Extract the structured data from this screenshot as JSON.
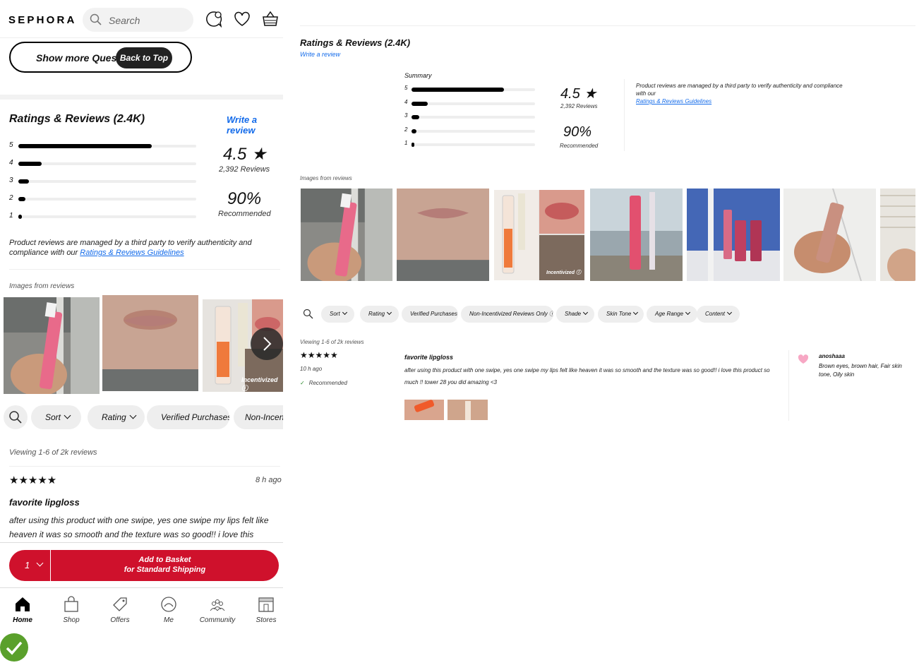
{
  "mobile": {
    "brand": "SEPHORA",
    "search_placeholder": "Search",
    "show_more": "Show more Questions",
    "back_to_top": "Back to Top",
    "section_title": "Ratings & Reviews (2.4K)",
    "write_review": "Write a review",
    "histogram": [
      {
        "label": "5",
        "value": 0.75
      },
      {
        "label": "4",
        "value": 0.13
      },
      {
        "label": "3",
        "value": 0.06
      },
      {
        "label": "2",
        "value": 0.04
      },
      {
        "label": "1",
        "value": 0.02
      }
    ],
    "rating": "4.5 ★",
    "review_count": "2,392 Reviews",
    "recommended_pct": "90%",
    "recommended_label": "Recommended",
    "disclaimer": "Product reviews are managed by a third party to verify authenticity and compliance with our",
    "guidelines_link": "Ratings & Reviews Guidelines",
    "images_label": "Images from reviews",
    "incentivized": "Incentivized ⓘ",
    "chips": [
      "Sort",
      "Rating",
      "Verified Purchases",
      "Non-Incentivi"
    ],
    "viewing": "Viewing 1-6 of 2k reviews",
    "stars": "★★★★★",
    "time_ago": "8 h ago",
    "review_title": "favorite lipgloss",
    "review_text": "after using this product with one swipe, yes one swipe my lips felt like heaven it was so smooth and the texture was so good!! i love this product",
    "qty": "1",
    "add_basket": "Add to Basket",
    "shipping": "for Standard Shipping",
    "nav": [
      "Home",
      "Shop",
      "Offers",
      "Me",
      "Community",
      "Stores"
    ]
  },
  "desktop": {
    "section_title": "Ratings & Reviews (2.4K)",
    "write_review": "Write a review",
    "summary": "Summary",
    "histogram": [
      {
        "label": "5",
        "value": 0.75
      },
      {
        "label": "4",
        "value": 0.13
      },
      {
        "label": "3",
        "value": 0.06
      },
      {
        "label": "2",
        "value": 0.04
      },
      {
        "label": "1",
        "value": 0.02
      }
    ],
    "rating": "4.5 ★",
    "review_count": "2,392 Reviews",
    "recommended_pct": "90%",
    "recommended_label": "Recommended",
    "disclaimer": "Product reviews are managed by a third party to verify authenticity and compliance with our",
    "guidelines_link": "Ratings & Reviews Guidelines",
    "images_label": "Images from reviews",
    "incentivized": "Incentivized ⓘ",
    "chips": [
      "Sort",
      "Rating",
      "Verified Purchases",
      "Non-Incentivized Reviews Only ⓘ",
      "Shade",
      "Skin Tone",
      "Age Range",
      "Content"
    ],
    "viewing": "Viewing 1-6 of 2k reviews",
    "stars": "★★★★★",
    "time_ago": "10 h ago",
    "recommended_tag": "Recommended",
    "review_title": "favorite lipgloss",
    "review_text": "after using this product with one swipe, yes one swipe my lips felt like heaven it was so smooth and the texture was so good!! i love this product so much !! tower 28 you did amazing <3",
    "username": "anoshaaa",
    "user_traits": "Brown eyes, brown hair, Fair skin tone, Oily skin"
  },
  "colors": {
    "accent": "#cf112c",
    "link": "#136bea",
    "check": "#5aa02c"
  }
}
